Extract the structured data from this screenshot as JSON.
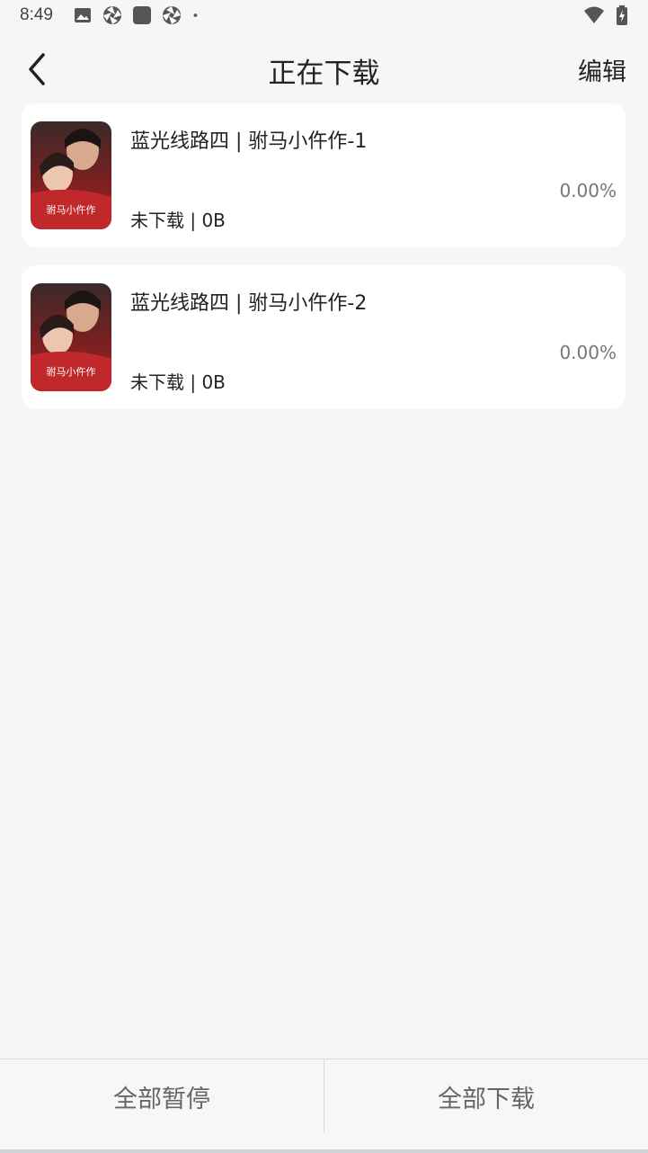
{
  "status_bar": {
    "time": "8:49",
    "left_icons": [
      "image-icon",
      "aperture-icon",
      "square-app-icon",
      "aperture-icon",
      "dot-icon"
    ],
    "right_icons": [
      "wifi-icon",
      "battery-charging-icon"
    ]
  },
  "header": {
    "title": "正在下载",
    "edit_label": "编辑",
    "back_icon": "chevron-left-icon"
  },
  "downloads": [
    {
      "title": "蓝光线路四 | 驸马小仵作-1",
      "status": "未下载 | 0B",
      "progress": "0.00%",
      "poster_text": "驸马小仵作"
    },
    {
      "title": "蓝光线路四 | 驸马小仵作-2",
      "status": "未下载 | 0B",
      "progress": "0.00%",
      "poster_text": "驸马小仵作"
    }
  ],
  "bottom": {
    "pause_all": "全部暂停",
    "download_all": "全部下载"
  },
  "colors": {
    "background": "#f6f6f6",
    "card": "#ffffff",
    "text": "#222222",
    "muted": "#777777"
  }
}
